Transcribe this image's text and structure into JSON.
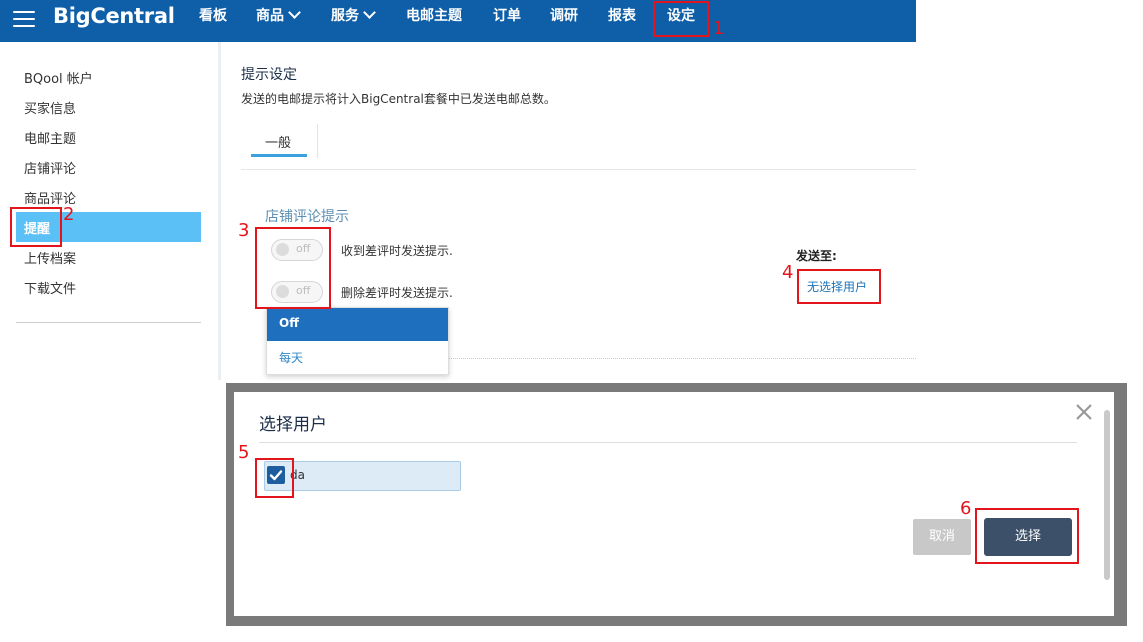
{
  "app": {
    "logo": "BigCentral"
  },
  "nav": {
    "items": [
      {
        "label": "看板"
      },
      {
        "label": "商品"
      },
      {
        "label": "服务"
      },
      {
        "label": "电邮主题"
      },
      {
        "label": "订单"
      },
      {
        "label": "调研"
      },
      {
        "label": "报表"
      },
      {
        "label": "设定"
      }
    ]
  },
  "sidebar": {
    "items": [
      {
        "label": "BQool 帐户"
      },
      {
        "label": "买家信息"
      },
      {
        "label": "电邮主题"
      },
      {
        "label": "店铺评论"
      },
      {
        "label": "商品评论"
      },
      {
        "label": "提醒"
      },
      {
        "label": "上传档案"
      },
      {
        "label": "下载文件"
      }
    ],
    "active_index": 5
  },
  "main": {
    "title": "提示设定",
    "description": "发送的电邮提示将计入BigCentral套餐中已发送电邮总数。",
    "tab": "一般",
    "section_title": "店铺评论提示",
    "toggles": [
      {
        "state": "off",
        "label": "收到差评时发送提示."
      },
      {
        "state": "off",
        "label": "删除差评时发送提示."
      }
    ],
    "send_to_label": "发送至:",
    "send_to_link": "无选择用户",
    "dropdown": {
      "options": [
        "Off",
        "每天"
      ],
      "selected": "Off"
    }
  },
  "modal": {
    "title": "选择用户",
    "close_glyph": "×",
    "user": {
      "name": "da",
      "checked": true
    },
    "cancel_label": "取消",
    "select_label": "选择"
  },
  "annotations": {
    "numbers": [
      "1",
      "2",
      "3",
      "4",
      "5",
      "6"
    ],
    "color": "#e3141b"
  },
  "colors": {
    "nav_bg": "#0e5fa8",
    "sidebar_active": "#5bc0f5",
    "link": "#1a73b8",
    "primary_button": "#3c506a"
  }
}
